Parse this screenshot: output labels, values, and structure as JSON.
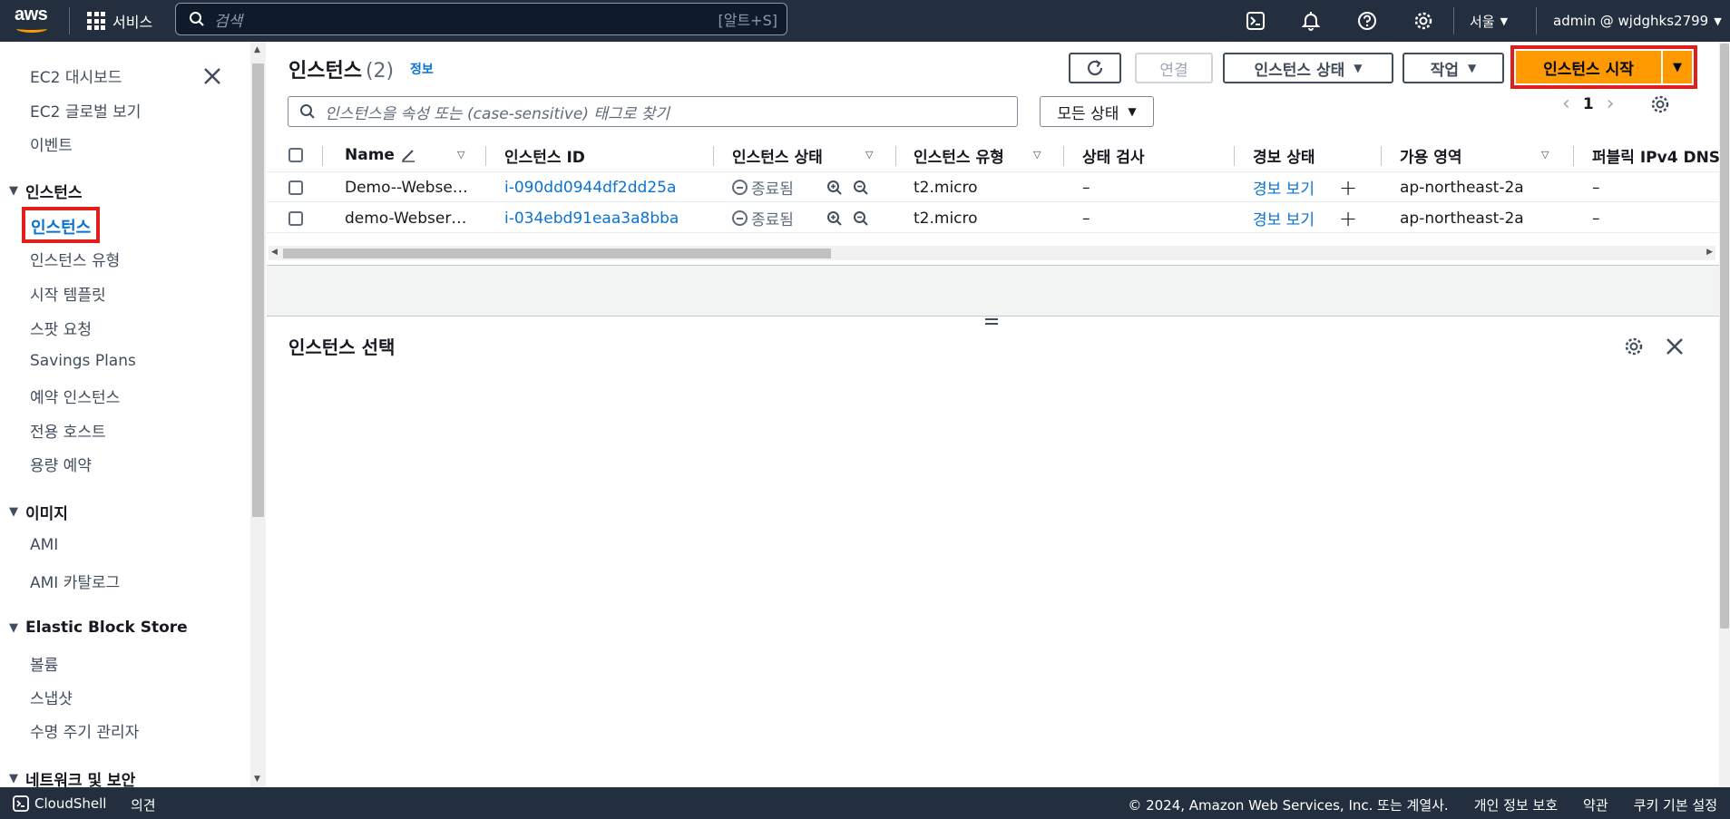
{
  "topbar": {
    "logo_text": "aws",
    "services_label": "서비스",
    "search_placeholder": "검색",
    "search_shortcut": "[알트+S]",
    "region_label": "서울",
    "account_label": "admin @ wjdghks2799"
  },
  "sidebar": {
    "items_top": [
      "EC2 대시보드",
      "EC2 글로벌 보기",
      "이벤트"
    ],
    "section_instances": "인스턴스",
    "instances_items": [
      "인스턴스",
      "인스턴스 유형",
      "시작 템플릿",
      "스팟 요청",
      "Savings Plans",
      "예약 인스턴스",
      "전용 호스트",
      "용량 예약"
    ],
    "section_images": "이미지",
    "images_items": [
      "AMI",
      "AMI 카탈로그"
    ],
    "section_ebs": "Elastic Block Store",
    "ebs_items": [
      "볼륨",
      "스냅샷",
      "수명 주기 관리자"
    ],
    "section_network": "네트워크 및 보안"
  },
  "header": {
    "title": "인스턴스",
    "count": "(2)",
    "info": "정보",
    "connect_label": "연결",
    "instance_state_label": "인스턴스 상태",
    "actions_label": "작업",
    "launch_label": "인스턴스 시작"
  },
  "filter": {
    "placeholder": "인스턴스을 속성 또는 (case-sensitive) 태그로 찾기",
    "state_filter": "모든 상태",
    "page": "1"
  },
  "table": {
    "columns": [
      "Name",
      "인스턴스 ID",
      "인스턴스 상태",
      "인스턴스 유형",
      "상태 검사",
      "경보 상태",
      "가용 영역",
      "퍼블릭 IPv4 DNS"
    ],
    "rows": [
      {
        "name": "Demo--Webse…",
        "id": "i-090dd0944df2dd25a",
        "state": "종료됨",
        "type": "t2.micro",
        "check": "–",
        "alarm": "경보 보기",
        "az": "ap-northeast-2a",
        "dns": "–"
      },
      {
        "name": "demo-Webser…",
        "id": "i-034ebd91eaa3a8bba",
        "state": "종료됨",
        "type": "t2.micro",
        "check": "–",
        "alarm": "경보 보기",
        "az": "ap-northeast-2a",
        "dns": "–"
      }
    ]
  },
  "detail": {
    "title": "인스턴스 선택"
  },
  "footer": {
    "cloudshell": "CloudShell",
    "feedback": "의견",
    "copyright": "© 2024, Amazon Web Services, Inc. 또는 계열사.",
    "privacy": "개인 정보 보호",
    "terms": "약관",
    "cookies": "쿠키 기본 설정"
  },
  "colors": {
    "topbar": "#232f3e",
    "accent": "#ff9900",
    "link": "#0972d3",
    "highlight": "#e01e1e"
  }
}
